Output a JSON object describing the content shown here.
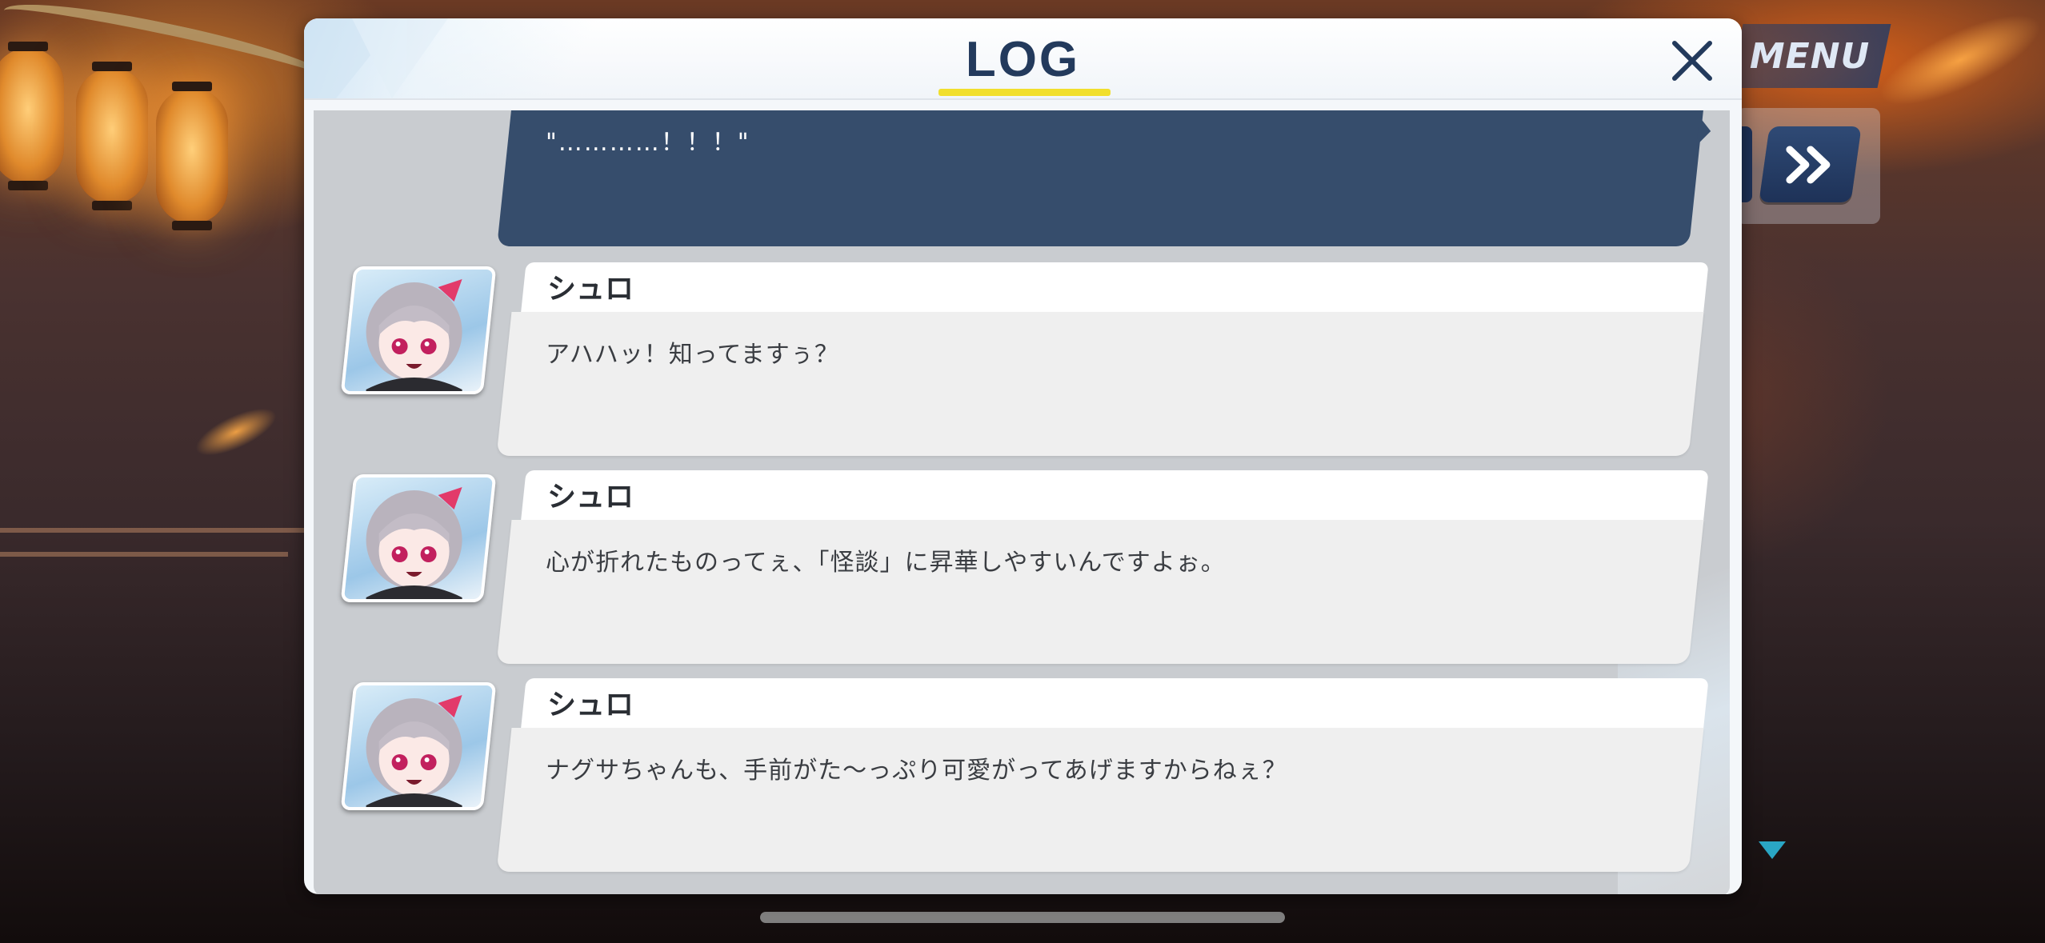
{
  "dialog": {
    "title": "LOG",
    "close_icon": "close-icon"
  },
  "hud": {
    "menu_label": "MENU",
    "fast_forward_icon": "fast-forward-icon",
    "scroll_indicator_icon": "triangle-down-icon"
  },
  "colors": {
    "title": "#233a5c",
    "underline": "#f1df2d",
    "player_bubble": "#364d6c",
    "message_box": "#efefef",
    "log_body": "#c9ccd0"
  },
  "log": {
    "player_line": "\"…………！！！\"",
    "entries": [
      {
        "speaker": "シュロ",
        "text": "アハハッ！知ってますぅ？"
      },
      {
        "speaker": "シュロ",
        "text": "心が折れたものってぇ、「怪談」に昇華しやすいんですよぉ。"
      },
      {
        "speaker": "シュロ",
        "text": "ナグサちゃんも、手前がた～っぷり可愛がってあげますからねぇ？"
      }
    ]
  }
}
